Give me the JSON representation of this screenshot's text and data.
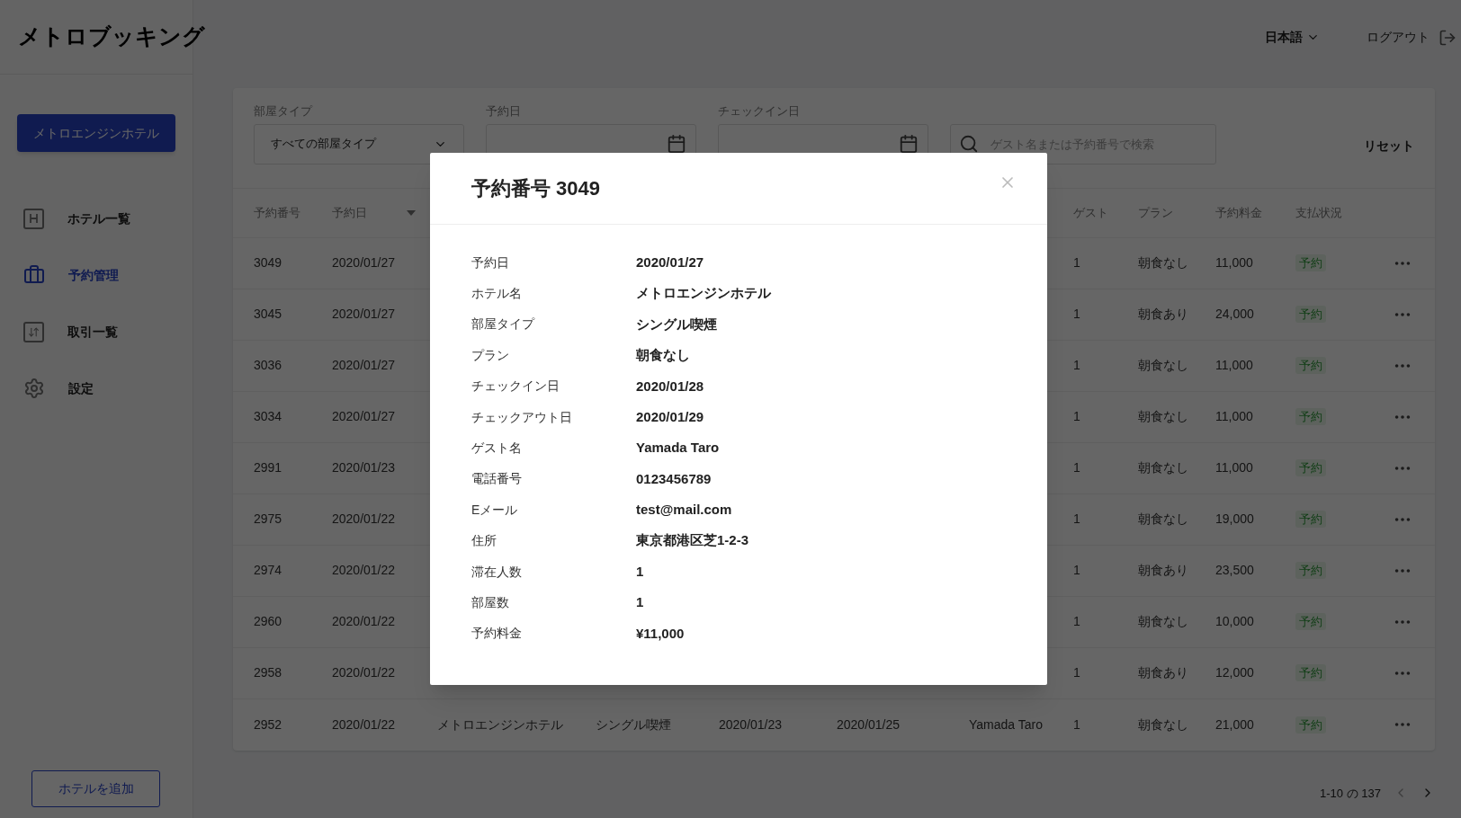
{
  "header": {
    "logo": "メトロブッキング",
    "language": "日本語",
    "logout": "ログアウト"
  },
  "sidebar": {
    "hotel_button": "メトロエンジンホテル",
    "items": [
      {
        "label": "ホテル一覧",
        "kind": "hotel",
        "selected": false
      },
      {
        "label": "予約管理",
        "kind": "booking",
        "selected": true
      },
      {
        "label": "取引一覧",
        "kind": "transactions",
        "selected": false
      },
      {
        "label": "設定",
        "kind": "settings",
        "selected": false
      }
    ],
    "add_button": "ホテルを追加"
  },
  "filters": {
    "room_type": {
      "label": "部屋タイプ",
      "value": "すべての部屋タイプ"
    },
    "booking_date": {
      "label": "予約日"
    },
    "checkin_date": {
      "label": "チェックイン日"
    },
    "search": {
      "placeholder": "ゲスト名または予約番号で検索"
    },
    "reset": "リセット"
  },
  "table": {
    "headers": {
      "id": "予約番号",
      "date": "予約日",
      "guests": "ゲスト",
      "plan": "プラン",
      "amount": "予約料金",
      "status": "支払状況"
    },
    "rows": [
      {
        "id": "3049",
        "date": "2020/01/27",
        "guests": "1",
        "plan": "朝食なし",
        "amount": "11,000",
        "status": "予約"
      },
      {
        "id": "3045",
        "date": "2020/01/27",
        "guests": "1",
        "plan": "朝食あり",
        "amount": "24,000",
        "status": "予約"
      },
      {
        "id": "3036",
        "date": "2020/01/27",
        "guests": "1",
        "plan": "朝食なし",
        "amount": "11,000",
        "status": "予約"
      },
      {
        "id": "3034",
        "date": "2020/01/27",
        "guests": "1",
        "plan": "朝食なし",
        "amount": "11,000",
        "status": "予約"
      },
      {
        "id": "2991",
        "date": "2020/01/23",
        "guests": "1",
        "plan": "朝食なし",
        "amount": "11,000",
        "status": "予約"
      },
      {
        "id": "2975",
        "date": "2020/01/22",
        "guests": "1",
        "plan": "朝食なし",
        "amount": "19,000",
        "status": "予約"
      },
      {
        "id": "2974",
        "date": "2020/01/22",
        "guests": "1",
        "plan": "朝食あり",
        "amount": "23,500",
        "status": "予約"
      },
      {
        "id": "2960",
        "date": "2020/01/22",
        "guests": "1",
        "plan": "朝食なし",
        "amount": "10,000",
        "status": "予約"
      },
      {
        "id": "2958",
        "date": "2020/01/22",
        "guests": "1",
        "plan": "朝食あり",
        "amount": "12,000",
        "status": "予約"
      },
      {
        "id": "2952",
        "date": "2020/01/22",
        "column_3": "メトロエンジンホテル",
        "column_4": "シングル喫煙",
        "column_5": "2020/01/23",
        "column_6": "2020/01/25",
        "column_7": "Yamada Taro",
        "guests": "1",
        "plan": "朝食なし",
        "amount": "21,000",
        "status": "予約"
      }
    ]
  },
  "pagination": {
    "range": "1-10 の 137"
  },
  "modal": {
    "title": "予約番号 3049",
    "fields": [
      {
        "label": "予約日",
        "value": "2020/01/27"
      },
      {
        "label": "ホテル名",
        "value": "メトロエンジンホテル"
      },
      {
        "label": "部屋タイプ",
        "value": "シングル喫煙"
      },
      {
        "label": "プラン",
        "value": "朝食なし"
      },
      {
        "label": "チェックイン日",
        "value": "2020/01/28"
      },
      {
        "label": "チェックアウト日",
        "value": "2020/01/29"
      },
      {
        "label": "ゲスト名",
        "value": "Yamada Taro"
      },
      {
        "label": "電話番号",
        "value": "0123456789"
      },
      {
        "label": "Eメール",
        "value": "test@mail.com"
      },
      {
        "label": "住所",
        "value": "東京都港区芝1-2-3"
      },
      {
        "label": "滞在人数",
        "value": "1"
      },
      {
        "label": "部屋数",
        "value": "1"
      },
      {
        "label": "予約料金",
        "value": "¥11,000"
      }
    ]
  }
}
